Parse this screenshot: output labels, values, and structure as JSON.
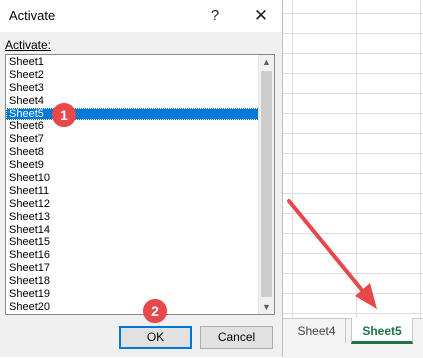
{
  "dialog": {
    "title": "Activate",
    "help": "?",
    "close": "✕",
    "list_label": "Activate:",
    "items": [
      "Sheet1",
      "Sheet2",
      "Sheet3",
      "Sheet4",
      "Sheet5",
      "Sheet6",
      "Sheet7",
      "Sheet8",
      "Sheet9",
      "Sheet10",
      "Sheet11",
      "Sheet12",
      "Sheet13",
      "Sheet14",
      "Sheet15",
      "Sheet16",
      "Sheet17",
      "Sheet18",
      "Sheet19",
      "Sheet20"
    ],
    "selected_index": 4,
    "scroll_up": "▲",
    "scroll_down": "▼",
    "ok_label": "OK",
    "cancel_label": "Cancel"
  },
  "tabs": {
    "inactive": "Sheet4",
    "active": "Sheet5"
  },
  "callouts": {
    "one": "1",
    "two": "2"
  },
  "colors": {
    "selection": "#0078d7",
    "callout": "#e8474b",
    "excel_green": "#217346"
  }
}
